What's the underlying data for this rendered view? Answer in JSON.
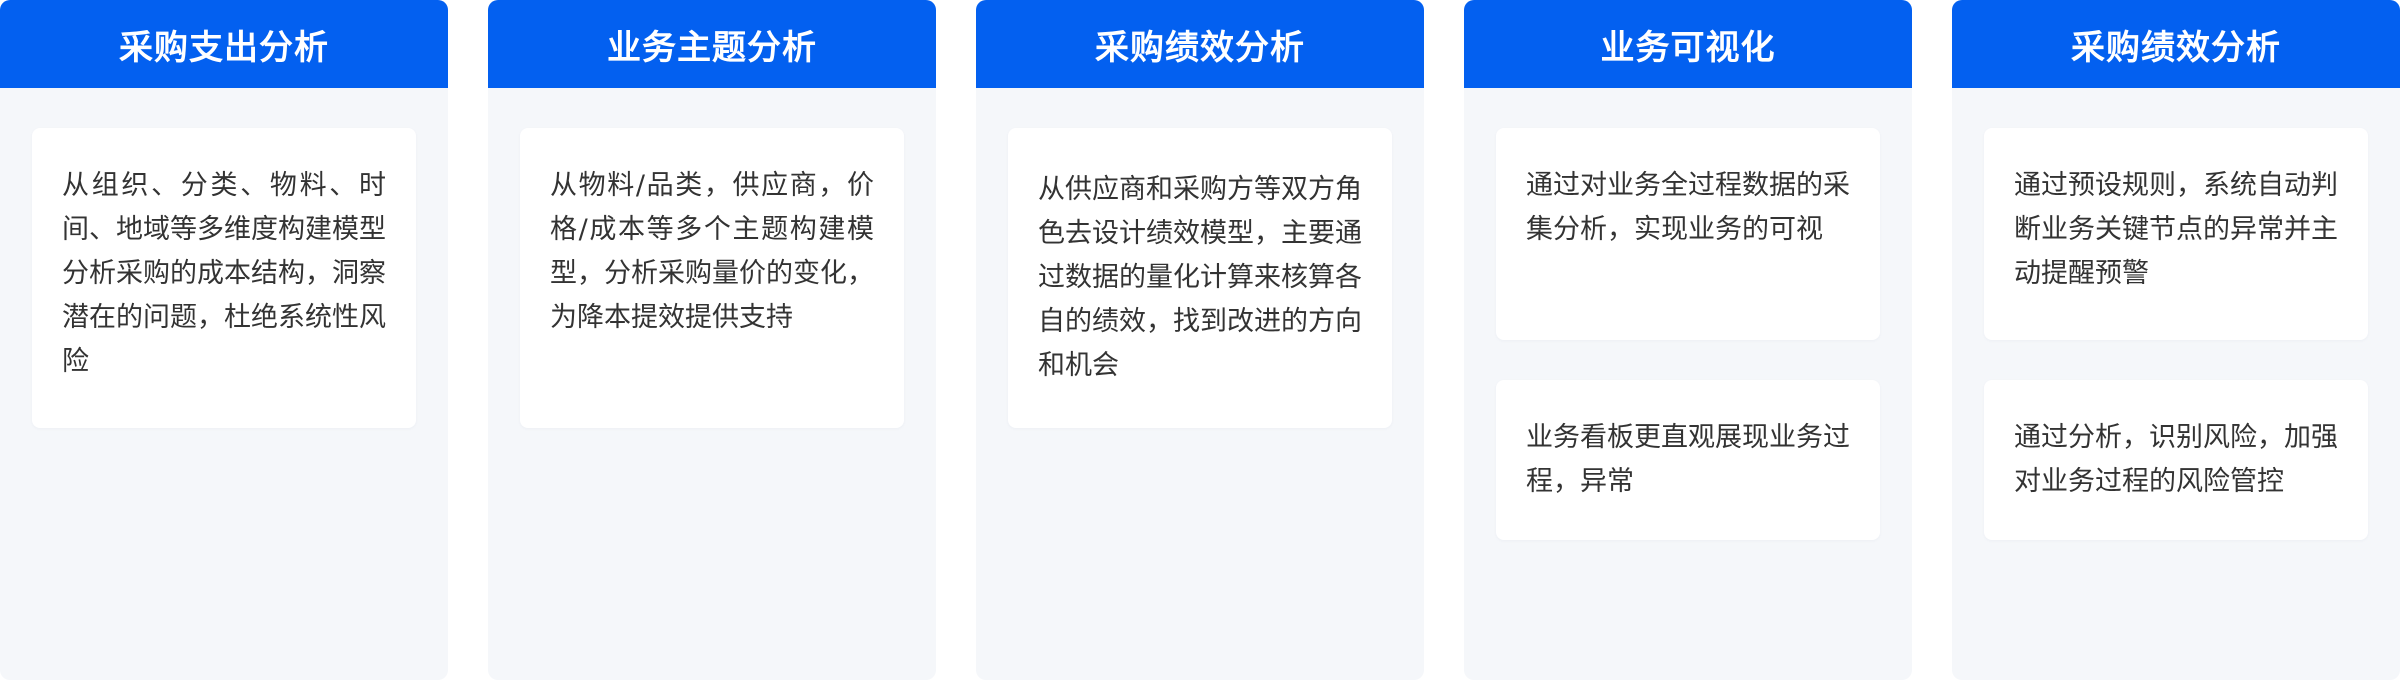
{
  "columns": [
    {
      "title": "采购支出分析",
      "cards": [
        "从组织、分类、物料、时间、地域等多维度构建模型分析采购的成本结构，洞察潜在的问题，杜绝系统性风险"
      ]
    },
    {
      "title": "业务主题分析",
      "cards": [
        "从物料/品类，供应商，价格/成本等多个主题构建模型，分析采购量价的变化，为降本提效提供支持"
      ]
    },
    {
      "title": "采购绩效分析",
      "cards": [
        "从供应商和采购方等双方角色去设计绩效模型，主要通过数据的量化计算来核算各自的绩效，找到改进的方向和机会"
      ]
    },
    {
      "title": "业务可视化",
      "cards": [
        "通过对业务全过程数据的采集分析，实现业务的可视",
        "业务看板更直观展现业务过程，异常"
      ]
    },
    {
      "title": "采购绩效分析",
      "cards": [
        "通过预设规则，系统自动判断业务关键节点的异常并主动提醒预警",
        "通过分析，识别风险，加强对业务过程的风险管控"
      ]
    }
  ],
  "colors": {
    "header_blue": "#0360f0",
    "column_bg": "#f5f7fa",
    "card_bg": "#ffffff",
    "text": "#333333"
  }
}
